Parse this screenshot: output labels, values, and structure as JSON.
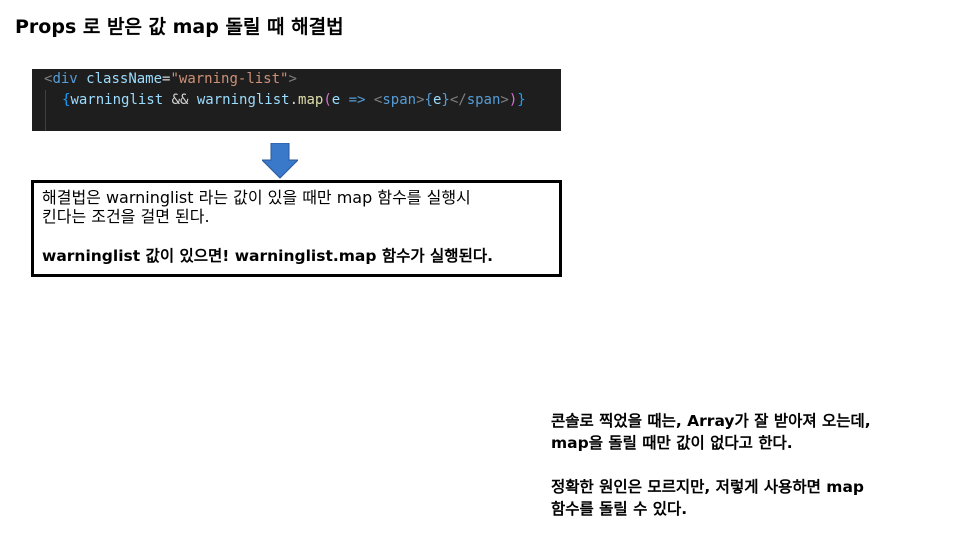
{
  "title": "Props 로 받은 값 map 돌릴 때 해결법",
  "code": {
    "line1": {
      "open_bracket": "<",
      "tag": "div",
      "attr": "className",
      "eq": "=",
      "value": "\"warning-list\"",
      "close_bracket": ">"
    },
    "line2": {
      "brace_open": "{",
      "var1": "warninglist",
      "and_op": " && ",
      "var2": "warninglist",
      "dot": ".",
      "fn": "map",
      "paren_open": "(",
      "param": "e",
      "arrow": " => ",
      "span_open_lt": "<",
      "span_tag": "span",
      "span_open_gt": ">",
      "inner_brace_open": "{",
      "inner_var": "e",
      "inner_brace_close": "}",
      "span_close_lt": "</",
      "span_close_tag": "span",
      "span_close_gt": ">",
      "paren_close": ")",
      "brace_close": "}"
    }
  },
  "arrow_icon": "down-arrow-icon",
  "colors": {
    "arrow": "#3a78c9",
    "code_bg": "#1e1e1e"
  },
  "note": {
    "line1": "해결법은 warninglist 라는 값이 있을 때만 map 함수를 실행시",
    "line2": "킨다는 조건을 걸면 된다.",
    "bold": "warninglist 값이 있으면! warninglist.map 함수가 실행된다."
  },
  "side": {
    "p1_line1": "콘솔로 찍었을 때는, Array가 잘 받아져 오는데,",
    "p1_line2": "map을 돌릴 때만 값이 없다고 한다.",
    "p2_line1": "정확한 원인은 모르지만, 저렇게 사용하면 map",
    "p2_line2": "함수를 돌릴 수 있다."
  }
}
